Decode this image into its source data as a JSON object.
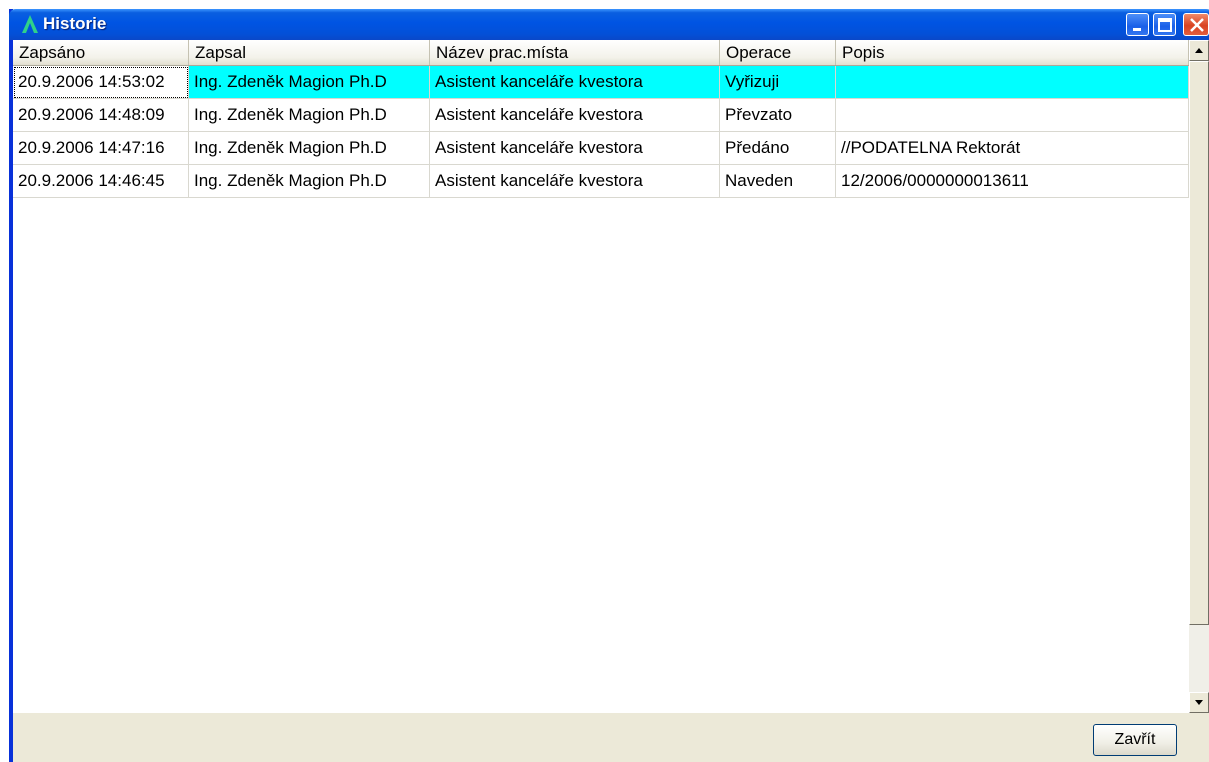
{
  "window": {
    "title": "Historie",
    "icons": {
      "app": "app-logo-icon",
      "minimize": "minimize-icon",
      "maximize": "maximize-icon",
      "close": "close-icon"
    }
  },
  "grid": {
    "columns": [
      "Zapsáno",
      "Zapsal",
      "Název prac.místa",
      "Operace",
      "Popis"
    ],
    "rows": [
      {
        "zapsano": "20.9.2006 14:53:02",
        "zapsal": "Ing. Zdeněk Magion Ph.D",
        "nazev": "Asistent kanceláře kvestora",
        "operace": "Vyřizuji",
        "popis": ""
      },
      {
        "zapsano": "20.9.2006 14:48:09",
        "zapsal": "Ing. Zdeněk Magion Ph.D",
        "nazev": "Asistent kanceláře kvestora",
        "operace": "Převzato",
        "popis": ""
      },
      {
        "zapsano": "20.9.2006 14:47:16",
        "zapsal": "Ing. Zdeněk Magion Ph.D",
        "nazev": "Asistent kanceláře kvestora",
        "operace": "Předáno",
        "popis": "//PODATELNA Rektorát"
      },
      {
        "zapsano": "20.9.2006 14:46:45",
        "zapsal": "Ing. Zdeněk Magion Ph.D",
        "nazev": "Asistent kanceláře kvestora",
        "operace": "Naveden",
        "popis": "12/2006/0000000013611"
      }
    ],
    "selected_row": 0,
    "selection_color": "#00ffff"
  },
  "footer": {
    "close_label": "Zavřít"
  },
  "colors": {
    "titlebar": "#0054e3",
    "window_face": "#ece9d8",
    "selection": "#00ffff"
  }
}
